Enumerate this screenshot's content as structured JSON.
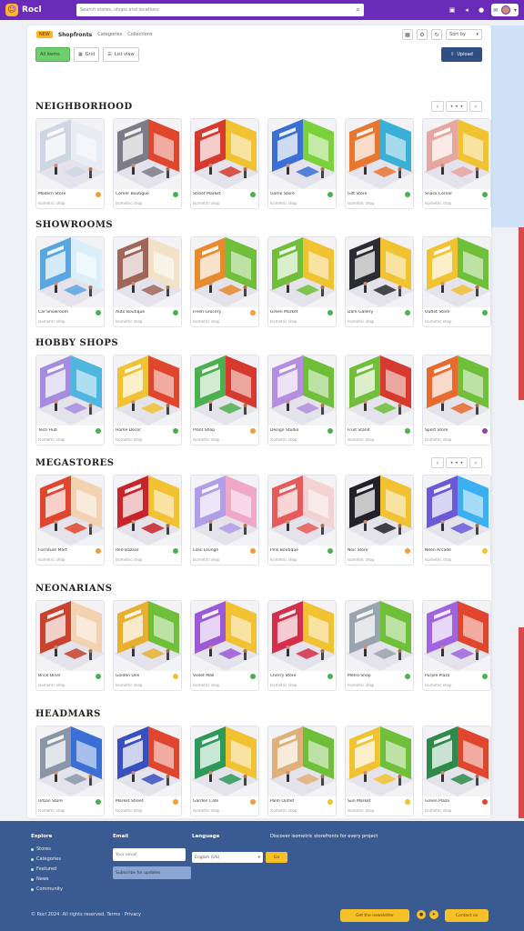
{
  "header": {
    "logo_glyph": "☺",
    "logo_text": "Rocl",
    "search_placeholder": "Search stores, shops and locations",
    "icons": [
      "cart-icon",
      "bell-icon",
      "chat-icon"
    ],
    "user_menu_caret": "▾"
  },
  "toolbar": {
    "badge": "NEW",
    "title": "Shopfronts",
    "crumb_1": "Categories",
    "crumb_2": "Collections",
    "sort_label": "Sort by",
    "filter_all": "All items",
    "filter_grid": "Grid",
    "filter_list": "List view",
    "primary_label": "Upload"
  },
  "sections": [
    {
      "title": "NEIGHBORHOOD",
      "cards": [
        {
          "name": "Modern Store",
          "sub": "Isometric shop",
          "color": "#cfd6e3",
          "accent": "#e8ecf3",
          "dot": "#f39c3a"
        },
        {
          "name": "Corner Boutique",
          "sub": "Isometric shop",
          "color": "#7c7c88",
          "accent": "#e0462e",
          "dot": "#4caf50"
        },
        {
          "name": "Street Market",
          "sub": "Isometric shop",
          "color": "#d63a2e",
          "accent": "#f1c232",
          "dot": "#4caf50"
        },
        {
          "name": "Game Store",
          "sub": "Isometric shop",
          "color": "#3a6fd6",
          "accent": "#7ad13a",
          "dot": "#4caf50"
        },
        {
          "name": "Gift Store",
          "sub": "Isometric shop",
          "color": "#e8762e",
          "accent": "#3ab0d6",
          "dot": "#4caf50"
        },
        {
          "name": "Snack Corner",
          "sub": "Isometric shop",
          "color": "#e8a6a0",
          "accent": "#f1c232",
          "dot": "#4caf50"
        }
      ]
    },
    {
      "title": "SHOWROOMS",
      "cards": [
        {
          "name": "Car Showroom",
          "sub": "Isometric shop",
          "color": "#5aa6e0",
          "accent": "#dbeffa",
          "dot": "#4caf50"
        },
        {
          "name": "Auto Boutique",
          "sub": "Isometric shop",
          "color": "#a0665a",
          "accent": "#f2e2c8",
          "dot": "#4caf50"
        },
        {
          "name": "Fresh Grocery",
          "sub": "Isometric shop",
          "color": "#e88a2e",
          "accent": "#6fbf3a",
          "dot": "#f39c3a"
        },
        {
          "name": "Green Market",
          "sub": "Isometric shop",
          "color": "#6fbf3a",
          "accent": "#f1c232",
          "dot": "#4caf50"
        },
        {
          "name": "Dark Gallery",
          "sub": "Isometric shop",
          "color": "#2c2c33",
          "accent": "#f1c232",
          "dot": "#4caf50"
        },
        {
          "name": "Outlet Store",
          "sub": "Isometric shop",
          "color": "#f1c232",
          "accent": "#6fbf3a",
          "dot": "#4caf50"
        }
      ]
    },
    {
      "title": "HOBBY SHOPS",
      "cards": [
        {
          "name": "Tech Hub",
          "sub": "Isometric shop",
          "color": "#a48de0",
          "accent": "#4fb6e0",
          "dot": "#4caf50"
        },
        {
          "name": "Home Decor",
          "sub": "Isometric shop",
          "color": "#f1c232",
          "accent": "#e0462e",
          "dot": "#4caf50"
        },
        {
          "name": "Plant Shop",
          "sub": "Isometric shop",
          "color": "#4caf50",
          "accent": "#d63a2e",
          "dot": "#f39c3a"
        },
        {
          "name": "Design Studio",
          "sub": "Isometric shop",
          "color": "#b48ee0",
          "accent": "#6fbf3a",
          "dot": "#4caf50"
        },
        {
          "name": "Fruit Stand",
          "sub": "Isometric shop",
          "color": "#6fbf3a",
          "accent": "#d63a2e",
          "dot": "#4caf50"
        },
        {
          "name": "Sport Store",
          "sub": "Isometric shop",
          "color": "#e86a2e",
          "accent": "#6fbf3a",
          "dot": "#8e44ad"
        }
      ]
    },
    {
      "title": "MEGASTORES",
      "cards": [
        {
          "name": "Furniture Mart",
          "sub": "Isometric shop",
          "color": "#e0462e",
          "accent": "#f2d2b0",
          "dot": "#f39c3a"
        },
        {
          "name": "Red Bazaar",
          "sub": "Isometric shop",
          "color": "#c8252a",
          "accent": "#f1c232",
          "dot": "#4caf50"
        },
        {
          "name": "Lilac Lounge",
          "sub": "Isometric shop",
          "color": "#b09ee8",
          "accent": "#f0a8c8",
          "dot": "#f39c3a"
        },
        {
          "name": "Pink Boutique",
          "sub": "Isometric shop",
          "color": "#e65a5a",
          "accent": "#f3d2d2",
          "dot": "#4caf50"
        },
        {
          "name": "Noir Store",
          "sub": "Isometric shop",
          "color": "#222228",
          "accent": "#f1c232",
          "dot": "#f39c3a"
        },
        {
          "name": "Neon Arcade",
          "sub": "Isometric shop",
          "color": "#6a5ad8",
          "accent": "#3ab0f0",
          "dot": "#f1c232"
        }
      ]
    },
    {
      "title": "NEONARIANS",
      "cards": [
        {
          "name": "Brick Diner",
          "sub": "Isometric shop",
          "color": "#c8422e",
          "accent": "#f2d2b0",
          "dot": "#4caf50"
        },
        {
          "name": "Golden Deli",
          "sub": "Isometric shop",
          "color": "#e8b02e",
          "accent": "#6fbf3a",
          "dot": "#f1c232"
        },
        {
          "name": "Violet Mall",
          "sub": "Isometric shop",
          "color": "#9b59d6",
          "accent": "#f1c232",
          "dot": "#4caf50"
        },
        {
          "name": "Cherry Store",
          "sub": "Isometric shop",
          "color": "#d62e4a",
          "accent": "#f1c232",
          "dot": "#4caf50"
        },
        {
          "name": "Metro Shop",
          "sub": "Isometric shop",
          "color": "#9aa4ae",
          "accent": "#6fbf3a",
          "dot": "#4caf50"
        },
        {
          "name": "Purple Plaza",
          "sub": "Isometric shop",
          "color": "#a064e0",
          "accent": "#e0462e",
          "dot": "#4caf50"
        }
      ]
    },
    {
      "title": "HEADMARS",
      "cards": [
        {
          "name": "Urban Store",
          "sub": "Isometric shop",
          "color": "#8a96a8",
          "accent": "#3a6fd6",
          "dot": "#4caf50"
        },
        {
          "name": "Market Street",
          "sub": "Isometric shop",
          "color": "#3a4fbf",
          "accent": "#e0462e",
          "dot": "#f39c3a"
        },
        {
          "name": "Garden Cafe",
          "sub": "Isometric shop",
          "color": "#2e9a5a",
          "accent": "#f1c232",
          "dot": "#f39c3a"
        },
        {
          "name": "Palm Outlet",
          "sub": "Isometric shop",
          "color": "#e0b07a",
          "accent": "#6fbf3a",
          "dot": "#f1c232"
        },
        {
          "name": "Sun Market",
          "sub": "Isometric shop",
          "color": "#f1c232",
          "accent": "#6fbf3a",
          "dot": "#f1c232"
        },
        {
          "name": "Green Plaza",
          "sub": "Isometric shop",
          "color": "#2e8a4a",
          "accent": "#e0462e",
          "dot": "#e0462e"
        }
      ]
    }
  ],
  "footer": {
    "col1_title": "Explore",
    "col1_links": [
      "Stores",
      "Categories",
      "Featured",
      "News",
      "Community"
    ],
    "col2_title": "Email",
    "col2_input": "Your email",
    "col2_hint": "Subscribe for updates",
    "col3_title": "Language",
    "col3_select": "English (US)",
    "col3_button": "Go",
    "col4_text": "Discover isometric storefronts for every project",
    "copyright": "© Rocl 2024. All rights reserved. Terms · Privacy",
    "cta_label": "Get the newsletter",
    "cta2_label": "Contact us"
  }
}
